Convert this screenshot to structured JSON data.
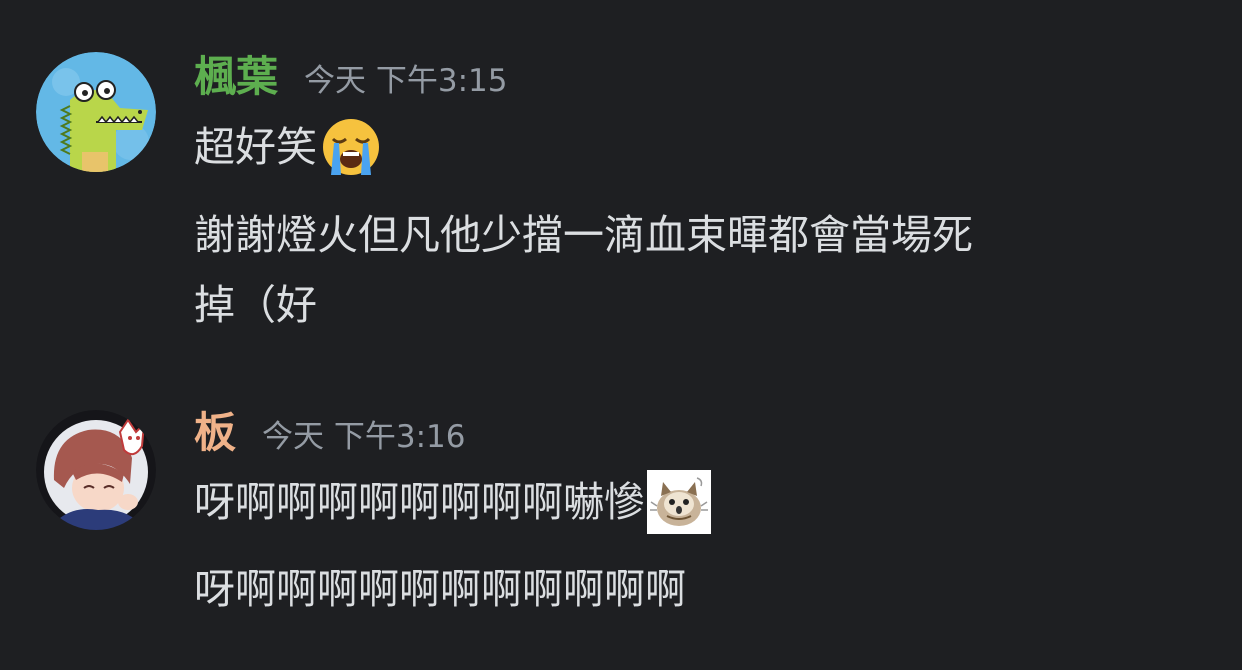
{
  "messages": [
    {
      "username": "楓葉",
      "username_color": "#5dae4f",
      "timestamp": "今天 下午3:15",
      "avatar_icon": "green-crocodile-avatar",
      "lines": {
        "l1": "超好笑",
        "l2": "謝謝燈火但凡他少擋一滴血束暉都會當場死",
        "l3": "掉（好"
      },
      "emoji": "loudly-crying-face-emoji"
    },
    {
      "username": "板",
      "username_color": "#f0b289",
      "timestamp": "今天 下午3:16",
      "avatar_icon": "anime-character-avatar",
      "lines": {
        "l1": "呀啊啊啊啊啊啊啊啊嚇慘",
        "l2": "呀啊啊啊啊啊啊啊啊啊啊啊"
      },
      "sticker": "scared-cat-sticker"
    }
  ]
}
